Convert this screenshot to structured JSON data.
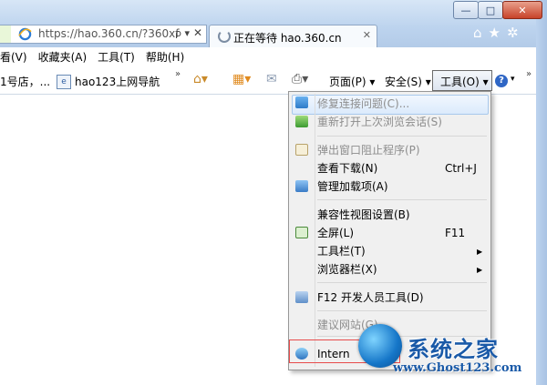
{
  "window": {
    "minimize_glyph": "—",
    "maximize_glyph": "□",
    "close_glyph": "✕"
  },
  "address": {
    "value": "https://hao.360.cn/?360xf",
    "search_glyph": "ρ ▾",
    "stop_glyph": "✕"
  },
  "tab": {
    "title": "正在等待 hao.360.cn",
    "close_glyph": "✕"
  },
  "toolbar_right": {
    "home_glyph": "⌂",
    "favorites_glyph": "★",
    "settings_glyph": "✲"
  },
  "menubar": {
    "items": [
      "看(V)",
      "收藏夹(A)",
      "工具(T)",
      "帮助(H)"
    ]
  },
  "favorites_bar": {
    "item1": "1号店，...",
    "item2": "hao123上网导航",
    "overflow": "»"
  },
  "commandbar": {
    "page": "页面(P) ▾",
    "safety": "安全(S) ▾",
    "tools": "工具(O) ▾",
    "help": "?",
    "overflow": "»"
  },
  "tools_menu": {
    "items": [
      {
        "label": "修复连接问题(C)...",
        "disabled": true
      },
      {
        "label": "重新打开上次浏览会话(S)",
        "disabled": true
      },
      {
        "label": "弹出窗口阻止程序(P)",
        "disabled": true
      },
      {
        "label": "查看下载(N)",
        "shortcut": "Ctrl+J"
      },
      {
        "label": "管理加载项(A)"
      },
      {
        "label": "兼容性视图设置(B)"
      },
      {
        "label": "全屏(L)",
        "shortcut": "F11"
      },
      {
        "label": "工具栏(T)",
        "submenu": true
      },
      {
        "label": "浏览器栏(X)",
        "submenu": true
      },
      {
        "label": "F12 开发人员工具(D)"
      },
      {
        "label": "建议网站(G)",
        "disabled": true
      },
      {
        "label": "Intern"
      }
    ],
    "submenu_arrow": "▶"
  },
  "watermark": {
    "title": "系统之家",
    "url": "www.Ghost123.com"
  },
  "colors": {
    "frame": "#bcd3ee",
    "menu_bg": "#f0f0f0",
    "disabled_text": "#8d8d8d",
    "highlight_border": "#e84b4b",
    "watermark": "#1a5aa8"
  }
}
